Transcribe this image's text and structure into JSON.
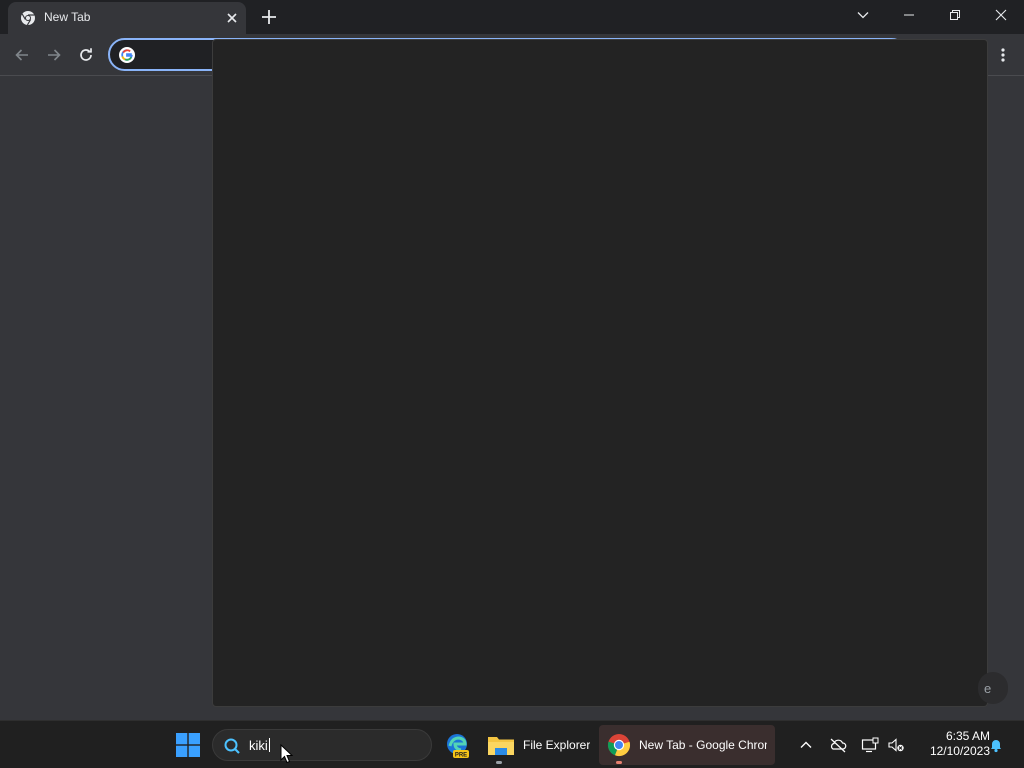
{
  "browser": {
    "tab": {
      "title": "New Tab",
      "favicon": "chrome-icon"
    },
    "new_tab_icon": "plus-icon",
    "window_controls": [
      "chevron-down-icon",
      "minimize-icon",
      "restore-icon",
      "close-icon"
    ],
    "toolbar": {
      "back_icon": "arrow-left-icon",
      "forward_icon": "arrow-right-icon",
      "reload_icon": "reload-icon",
      "omnibox_value": "",
      "omnibox_icon": "google-icon",
      "menu_icon": "kebab-menu-icon"
    },
    "peek_text": "e"
  },
  "taskbar": {
    "start_icon": "windows-logo-icon",
    "search": {
      "value": "kiki",
      "icon": "search-icon"
    },
    "apps": [
      {
        "name": "edge-dev",
        "icon": "edge-icon",
        "label": ""
      },
      {
        "name": "file-explorer",
        "icon": "folder-icon",
        "label": "File Explorer"
      },
      {
        "name": "chrome",
        "icon": "chrome-icon",
        "label": "New Tab - Google Chrome"
      }
    ],
    "tray": {
      "icons": [
        "chevron-up-icon",
        "cloud-off-icon",
        "display-icon",
        "volume-muted-icon"
      ],
      "time": "6:35 AM",
      "date": "12/10/2023",
      "notification_icon": "bell-icon"
    }
  },
  "colors": {
    "accent": "#8ab4f8",
    "tabstrip": "#202124",
    "toolbar": "#35363a",
    "dropdown": "#232323",
    "taskbar": "#202020",
    "windows_blue": "#3aa0ff"
  }
}
